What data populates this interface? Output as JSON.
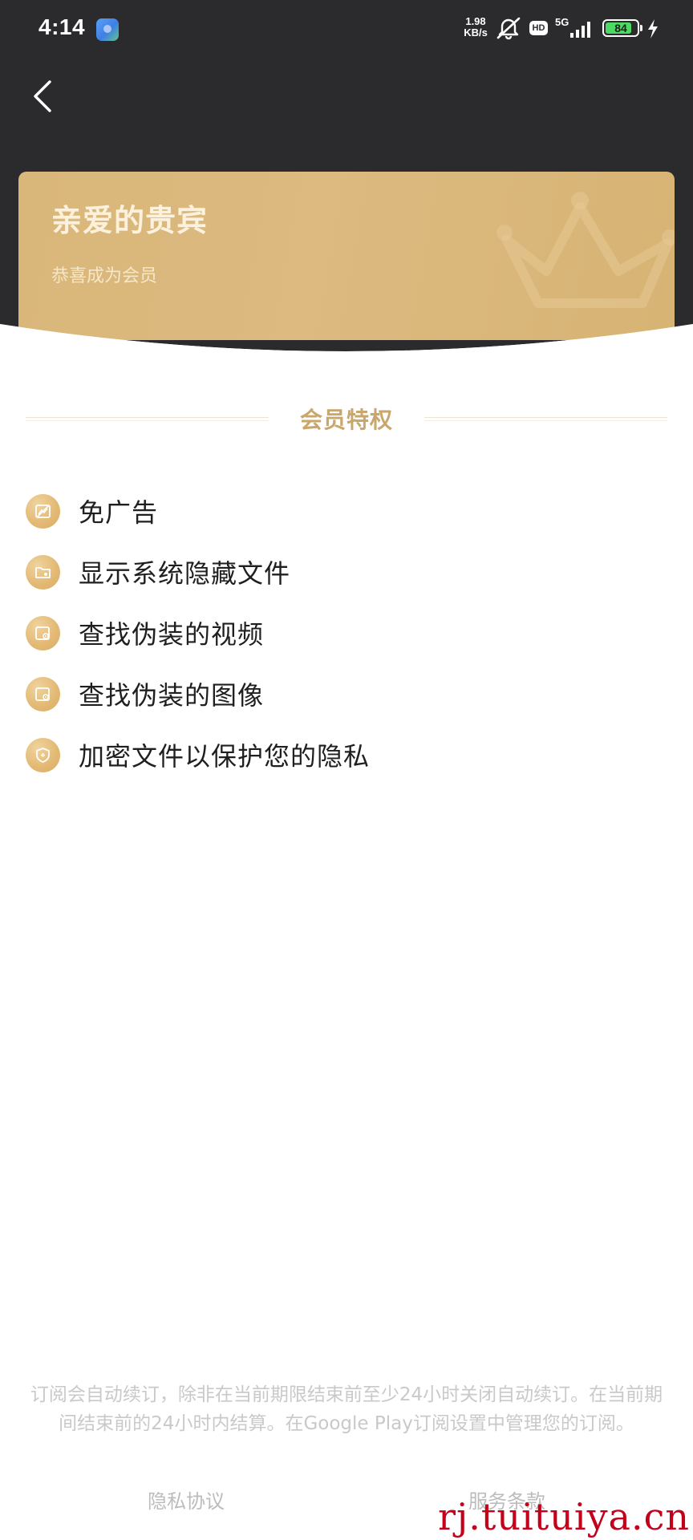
{
  "status_bar": {
    "time": "4:14",
    "net_speed_value": "1.98",
    "net_speed_unit": "KB/s",
    "hd_label": "HD",
    "network_label": "5G",
    "battery_level": "84",
    "battery_fill_fraction": 0.84,
    "icons": [
      "app-notification-icon",
      "mute-icon",
      "signal-icon",
      "battery-icon",
      "charging-icon"
    ]
  },
  "header": {
    "back_icon": "chevron-left-icon"
  },
  "member_card": {
    "title": "亲爱的贵宾",
    "subtitle": "恭喜成为会员",
    "decoration_icon": "crown-icon"
  },
  "privileges": {
    "section_title": "会员特权",
    "items": [
      {
        "label": "免广告",
        "icon": "no-ads-icon"
      },
      {
        "label": "显示系统隐藏文件",
        "icon": "folder-icon"
      },
      {
        "label": "查找伪装的视频",
        "icon": "video-icon"
      },
      {
        "label": "查找伪装的图像",
        "icon": "image-icon"
      },
      {
        "label": "加密文件以保护您的隐私",
        "icon": "shield-icon"
      }
    ]
  },
  "footer": {
    "subscription_note": "订阅会自动续订，除非在当前期限结束前至少24小时关闭自动续订。在当前期间结束前的24小时内结算。在Google Play订阅设置中管理您的订阅。",
    "privacy_link": "隐私协议",
    "terms_link": "服务条款"
  },
  "watermark": "rj.tuituiya.cn",
  "colors": {
    "header_bg": "#2b2b2d",
    "card_gold": "#dcba80",
    "accent_gold": "#c9a66b",
    "icon_gold": "#e2b872",
    "battery_green": "#4cd964",
    "watermark_red": "#c4001a"
  }
}
